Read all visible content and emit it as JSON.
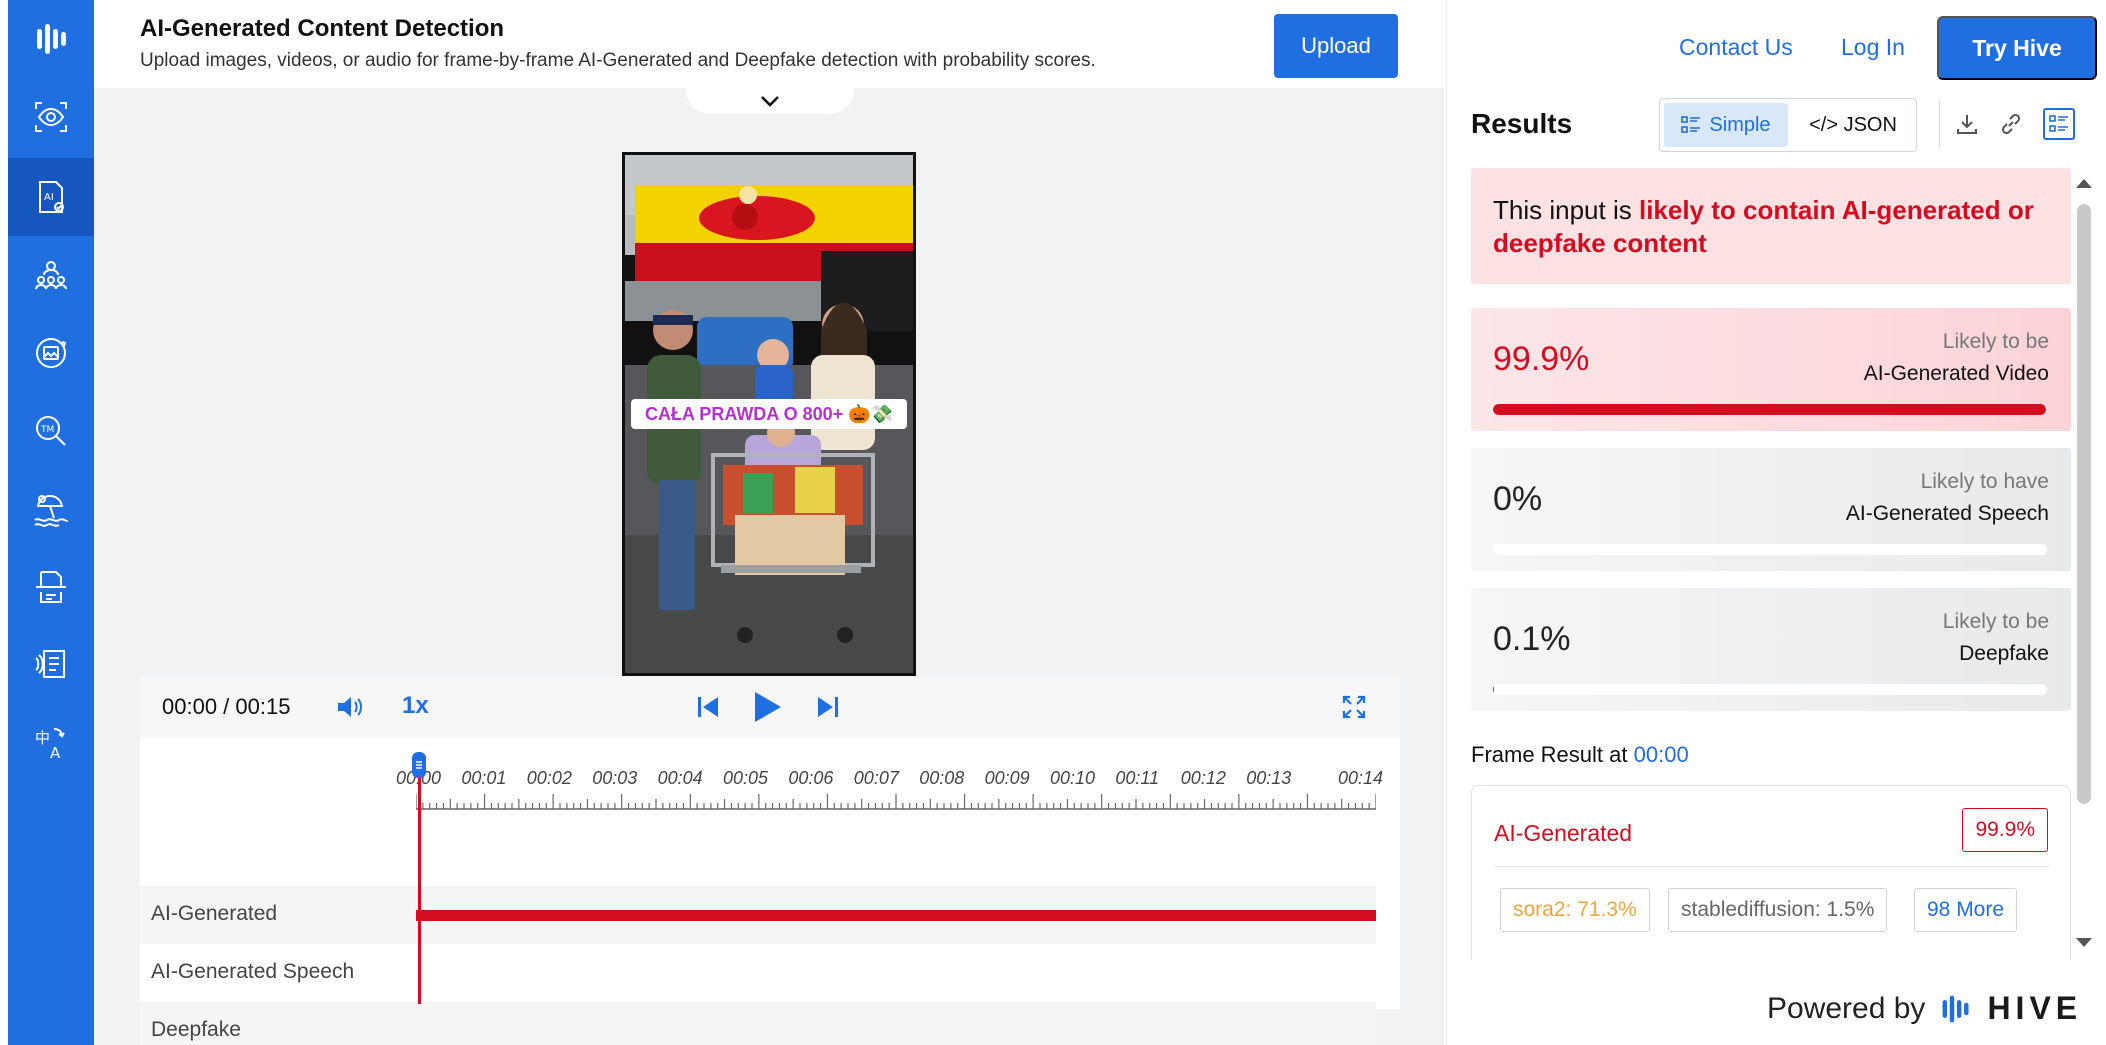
{
  "header": {
    "title": "AI-Generated Content Detection",
    "subtitle": "Upload images, videos, or audio for frame-by-frame AI-Generated and Deepfake detection with probability scores.",
    "upload_label": "Upload"
  },
  "nav": {
    "contact": "Contact Us",
    "login": "Log In",
    "try": "Try Hive"
  },
  "video": {
    "caption": "CAŁA PRAWDA O 800+ 🎃💸"
  },
  "player": {
    "current": "00:00",
    "duration": "00:15",
    "speed": "1x"
  },
  "timeline": {
    "ticks": [
      "00:00",
      "00:01",
      "00:02",
      "00:03",
      "00:04",
      "00:05",
      "00:06",
      "00:07",
      "00:08",
      "00:09",
      "00:10",
      "00:11",
      "00:12",
      "00:13",
      "00:14"
    ],
    "tracks": [
      {
        "label": "AI-Generated"
      },
      {
        "label": "AI-Generated Speech"
      },
      {
        "label": "Deepfake"
      }
    ]
  },
  "results": {
    "title": "Results",
    "view_simple": "Simple",
    "view_json": "</> JSON",
    "verdict_prefix": "This input is",
    "verdict_highlight": "likely to contain AI-generated or deepfake content",
    "scores": [
      {
        "value": "99.9%",
        "fraction": 0.999,
        "line1": "Likely to be",
        "line2": "AI-Generated Video"
      },
      {
        "value": "0%",
        "fraction": 0,
        "line1": "Likely to have",
        "line2": "AI-Generated Speech"
      },
      {
        "value": "0.1%",
        "fraction": 0.001,
        "line1": "Likely to be",
        "line2": "Deepfake"
      }
    ]
  },
  "frame_result": {
    "heading": "Frame Result at",
    "time": "00:00",
    "label": "AI-Generated",
    "score": "99.9%",
    "chips": [
      "sora2: 71.3%",
      "stablediffusion: 1.5%",
      "98 More"
    ]
  },
  "footer": {
    "powered_by": "Powered by",
    "brand": "HIVE"
  },
  "colors": {
    "brand_blue": "#1f6fe0",
    "alert_red": "#d30d1f",
    "warning_orange": "#f2a33a"
  }
}
